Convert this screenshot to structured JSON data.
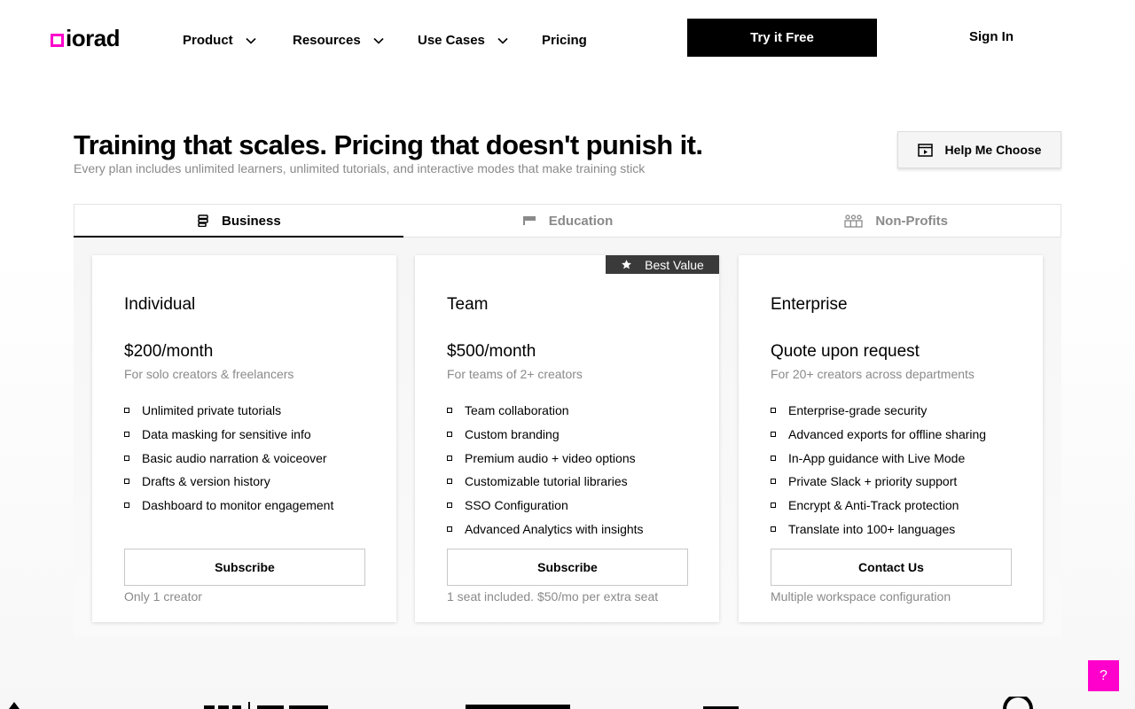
{
  "brand": {
    "logo_text": "iorad",
    "accent": "#ff00cc"
  },
  "nav": {
    "items": [
      {
        "label": "Product",
        "has_dropdown": true
      },
      {
        "label": "Resources",
        "has_dropdown": true
      },
      {
        "label": "Use Cases",
        "has_dropdown": true
      },
      {
        "label": "Pricing",
        "has_dropdown": false
      }
    ],
    "cta": "Try it Free",
    "sign_in": "Sign In"
  },
  "hero": {
    "title": "Training that scales. Pricing that doesn't punish it.",
    "subtitle": "Every plan includes unlimited learners, unlimited tutorials, and interactive modes that make training stick",
    "help_button": "Help Me Choose",
    "help_icon": "video-play-icon"
  },
  "tabs": [
    {
      "label": "Business",
      "icon": "stack-icon",
      "active": true
    },
    {
      "label": "Education",
      "icon": "flag-icon",
      "active": false
    },
    {
      "label": "Non-Profits",
      "icon": "group-icon",
      "active": false
    }
  ],
  "plans": [
    {
      "name": "Individual",
      "price": "$200/month",
      "audience": "For solo creators & freelancers",
      "features": [
        "Unlimited private tutorials",
        "Data masking for sensitive info",
        "Basic audio narration & voiceover",
        "Drafts & version history",
        "Dashboard to monitor engagement"
      ],
      "button": "Subscribe",
      "note": "Only 1 creator"
    },
    {
      "name": "Team",
      "badge": "Best Value",
      "badge_icon": "star-icon",
      "price": "$500/month",
      "audience": "For teams of 2+ creators",
      "features": [
        "Team collaboration",
        "Custom branding",
        "Premium audio + video options",
        "Customizable tutorial libraries",
        "SSO Configuration",
        "Advanced Analytics with insights"
      ],
      "button": "Subscribe",
      "note": "1 seat included. $50/mo per extra seat"
    },
    {
      "name": "Enterprise",
      "price": "Quote upon request",
      "audience": "For 20+ creators across departments",
      "features": [
        "Enterprise-grade security",
        "Advanced exports for offline sharing",
        "In-App guidance with Live Mode",
        "Private Slack + priority support",
        "Encrypt & Anti-Track protection",
        "Translate into 100+ languages"
      ],
      "button": "Contact Us",
      "note": "Multiple workspace configuration"
    }
  ],
  "help_fab": "?"
}
